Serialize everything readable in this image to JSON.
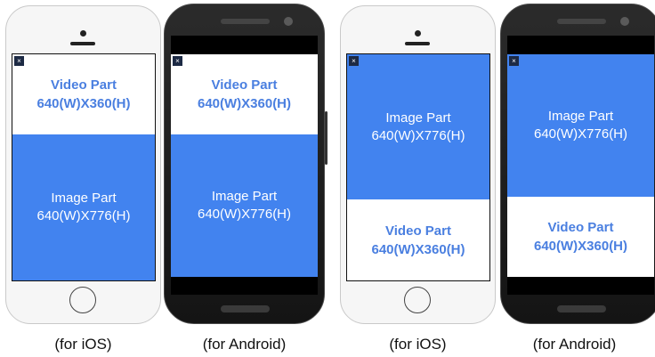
{
  "mockups": [
    {
      "platform": "ios",
      "caption": "(for iOS)",
      "order": [
        "video",
        "image"
      ],
      "video_label": "Video Part",
      "video_size": "640(W)X360(H)",
      "image_label": "Image Part",
      "image_size": "640(W)X776(H)",
      "close_glyph": "×"
    },
    {
      "platform": "android",
      "caption": "(for Android)",
      "order": [
        "video",
        "image"
      ],
      "video_label": "Video Part",
      "video_size": "640(W)X360(H)",
      "image_label": "Image Part",
      "image_size": "640(W)X776(H)",
      "close_glyph": "×"
    },
    {
      "platform": "ios",
      "caption": "(for iOS)",
      "order": [
        "image",
        "video"
      ],
      "video_label": "Video Part",
      "video_size": "640(W)X360(H)",
      "image_label": "Image Part",
      "image_size": "640(W)X776(H)",
      "close_glyph": "×"
    },
    {
      "platform": "android",
      "caption": "(for Android)",
      "order": [
        "image",
        "video"
      ],
      "video_label": "Video Part",
      "video_size": "640(W)X360(H)",
      "image_label": "Image Part",
      "image_size": "640(W)X776(H)",
      "close_glyph": "×"
    }
  ],
  "colors": {
    "image_part_bg": "#4283ef",
    "video_part_text": "#4a7fe0",
    "close_button_bg": "#1d2a44"
  }
}
